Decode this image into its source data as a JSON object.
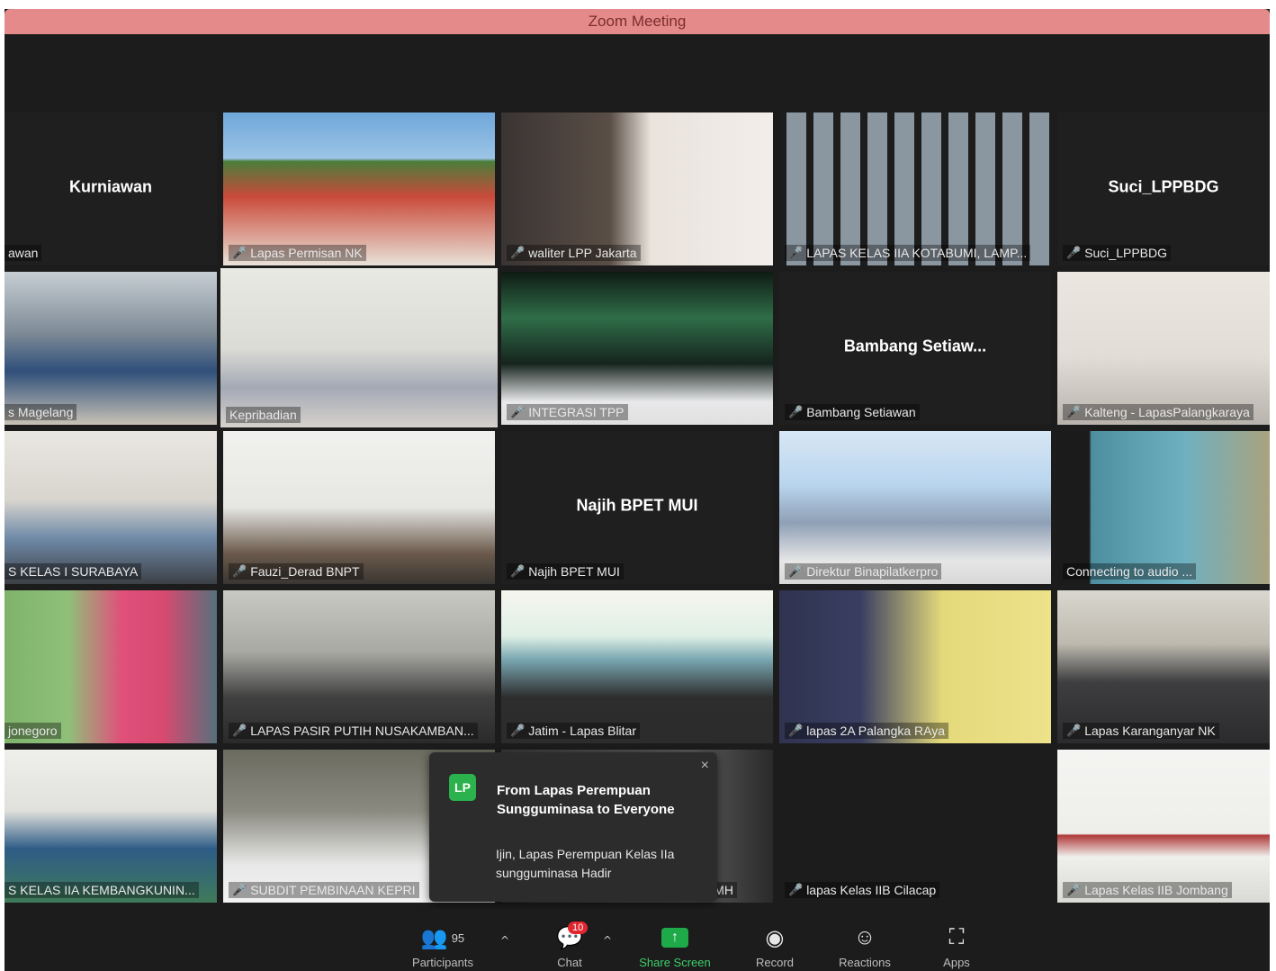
{
  "window": {
    "title": "Zoom Meeting"
  },
  "tiles": [
    {
      "name": "awan",
      "center": "Kurniawan",
      "muted": false
    },
    {
      "name": "Lapas Permisan NK",
      "center": "",
      "muted": true
    },
    {
      "name": "waliter LPP Jakarta",
      "center": "",
      "muted": true
    },
    {
      "name": "LAPAS KELAS IIA KOTABUMI, LAMP...",
      "center": "",
      "muted": true
    },
    {
      "name": "Suci_LPPBDG",
      "center": "Suci_LPPBDG",
      "muted": true
    },
    {
      "name": "s Magelang",
      "center": "",
      "muted": false
    },
    {
      "name": "Kepribadian",
      "center": "",
      "muted": false
    },
    {
      "name": "INTEGRASI TPP",
      "center": "",
      "muted": true
    },
    {
      "name": "Bambang Setiawan",
      "center": "Bambang Setiaw...",
      "muted": true
    },
    {
      "name": "Kalteng - LapasPalangkaraya",
      "center": "",
      "muted": true
    },
    {
      "name": "S KELAS I SURABAYA",
      "center": "",
      "muted": false
    },
    {
      "name": "Fauzi_Derad BNPT",
      "center": "",
      "muted": true
    },
    {
      "name": "Najih BPET MUI",
      "center": "Najih BPET MUI",
      "muted": true
    },
    {
      "name": "Direktur Binapilatkerpro",
      "center": "",
      "muted": true
    },
    {
      "name": "Connecting to audio ...",
      "center": "",
      "muted": false
    },
    {
      "name": "jonegoro",
      "center": "",
      "muted": false
    },
    {
      "name": "LAPAS PASIR PUTIH NUSAKAMBAN...",
      "center": "",
      "muted": true
    },
    {
      "name": "Jatim - Lapas Blitar",
      "center": "",
      "muted": true
    },
    {
      "name": "lapas 2A Palangka RAya",
      "center": "",
      "muted": true
    },
    {
      "name": "Lapas Karanganyar NK",
      "center": "",
      "muted": true
    },
    {
      "name": "S KELAS IIA KEMBANGKUNIN...",
      "center": "",
      "muted": false
    },
    {
      "name": "SUBDIT PEMBINAAN KEPRI",
      "center": "",
      "muted": true
    },
    {
      "name": "MH",
      "center": "",
      "muted": false
    },
    {
      "name": "lapas Kelas IIB Cilacap",
      "center": "",
      "muted": true
    },
    {
      "name": "Lapas Kelas IIB Jombang",
      "center": "",
      "muted": true
    }
  ],
  "chat_popup": {
    "avatar": "LP",
    "from": "From Lapas Perempuan Sungguminasa to Everyone",
    "message": "Ijin, Lapas Perempuan Kelas IIa sungguminasa Hadir",
    "close": "×"
  },
  "toolbar": {
    "participants": {
      "label": "Participants",
      "count": "95",
      "icon": "participants-icon"
    },
    "chat": {
      "label": "Chat",
      "badge": "10",
      "icon": "chat-icon"
    },
    "share": {
      "label": "Share Screen",
      "icon": "share-screen-icon"
    },
    "record": {
      "label": "Record",
      "icon": "record-icon"
    },
    "reactions": {
      "label": "Reactions",
      "icon": "reactions-icon"
    },
    "apps": {
      "label": "Apps",
      "icon": "apps-icon"
    }
  },
  "colors": {
    "mute": "#e0403a",
    "active_border": "#c6e46b",
    "share_green": "#1faa4a",
    "badge_red": "#e0262f",
    "titlebar": "#e58a8a"
  }
}
